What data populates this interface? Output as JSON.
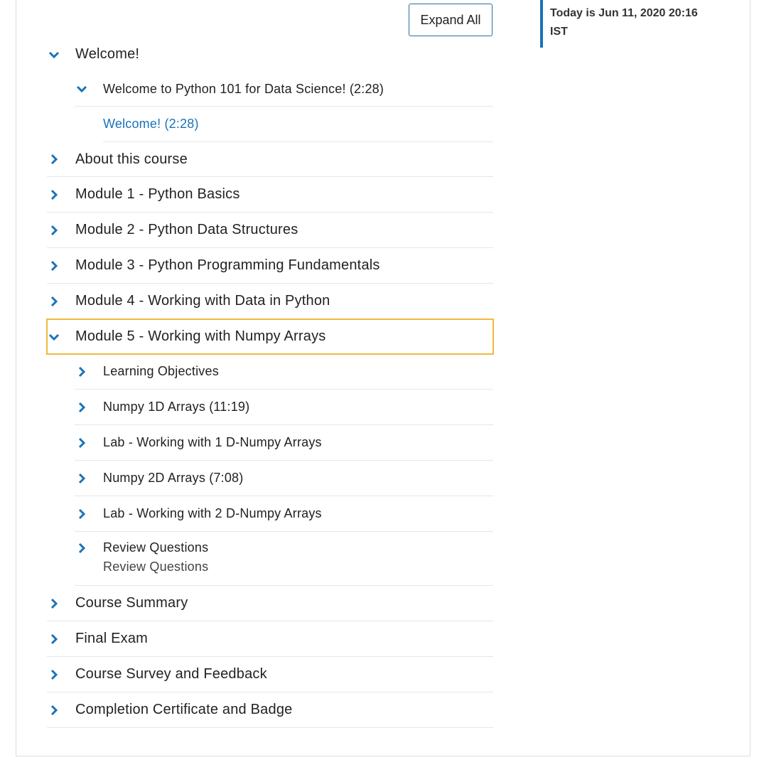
{
  "header": {
    "expand_all_label": "Expand All",
    "today_line1": "Today is Jun 11, 2020 20:16",
    "today_line2": "IST"
  },
  "colors": {
    "accent": "#1a73b8",
    "selected_outline": "#f0b840"
  },
  "tree": {
    "welcome": {
      "label": "Welcome!",
      "child": {
        "label": "Welcome to Python 101 for Data Science! (2:28)",
        "link": "Welcome! (2:28)"
      }
    },
    "about": "About this course",
    "module1": "Module 1 - Python Basics",
    "module2": "Module 2 - Python Data Structures",
    "module3": "Module 3 - Python Programming Fundamentals",
    "module4": "Module 4 - Working with Data in Python",
    "module5": {
      "label": "Module 5 - Working with Numpy Arrays",
      "items": [
        "Learning Objectives",
        "Numpy 1D Arrays (11:19)",
        "Lab - Working with 1 D-Numpy Arrays",
        "Numpy 2D Arrays (7:08)",
        "Lab - Working with 2 D-Numpy Arrays",
        "Review Questions"
      ],
      "review_sub": "Review Questions"
    },
    "summary": "Course Summary",
    "final": "Final Exam",
    "survey": "Course Survey and Feedback",
    "certificate": "Completion Certificate and Badge"
  },
  "icons": {
    "expanded": "chevron-down-icon",
    "collapsed": "chevron-right-icon"
  }
}
